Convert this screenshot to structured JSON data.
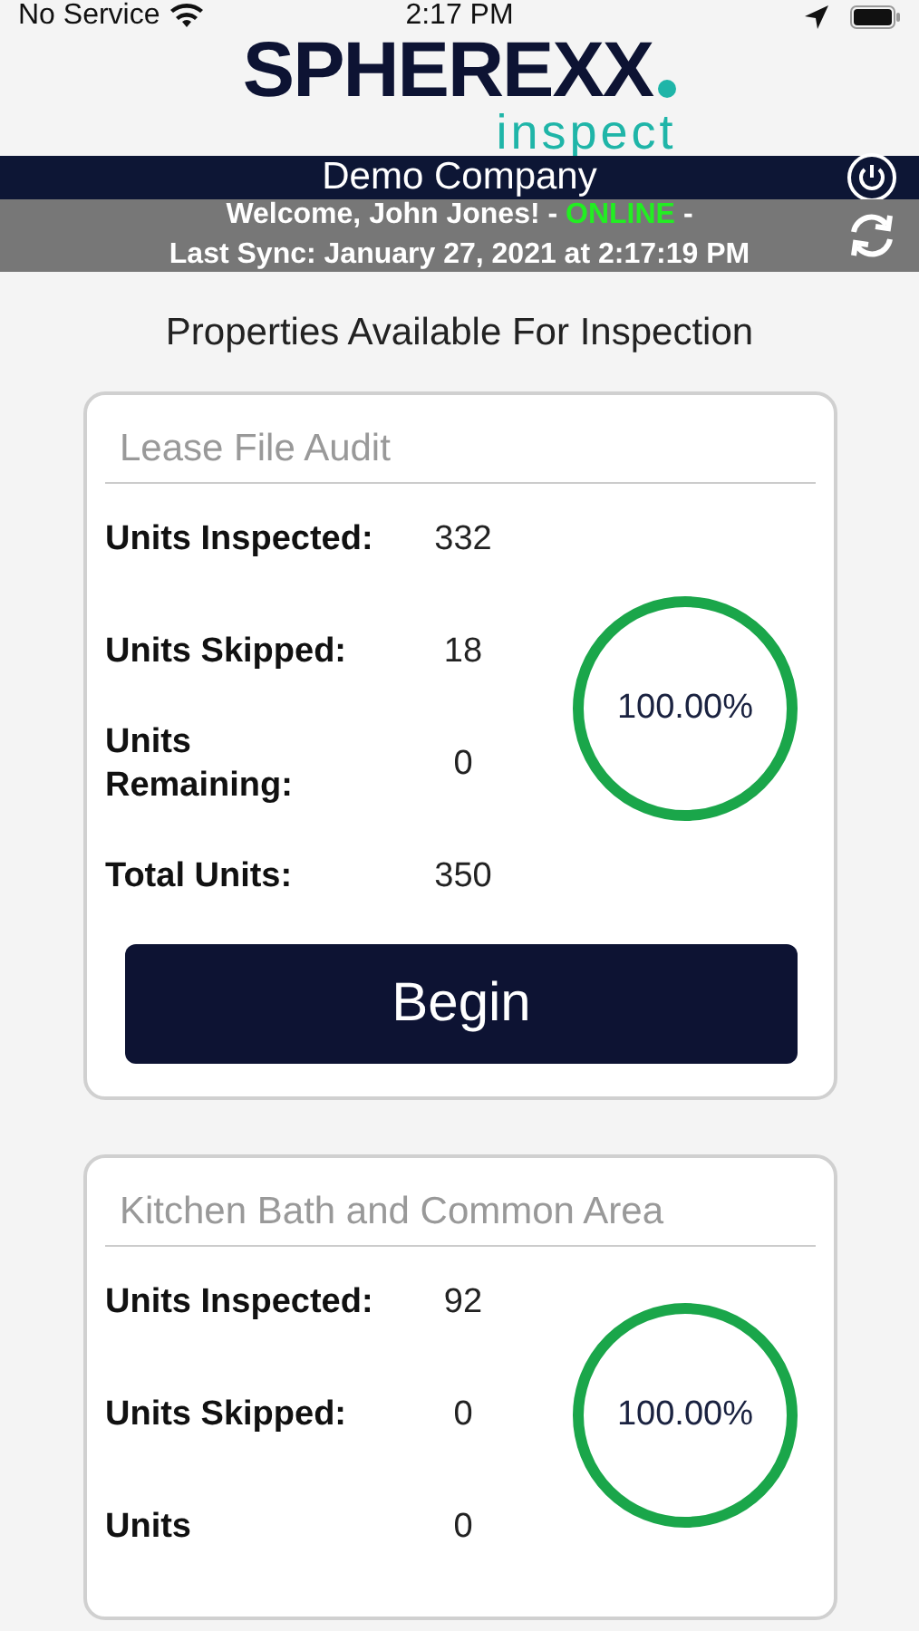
{
  "status_bar": {
    "carrier": "No Service",
    "time": "2:17 PM"
  },
  "logo": {
    "brand": "SPHEREXX",
    "product": "inspect"
  },
  "header": {
    "title": "Demo Company"
  },
  "sync_bar": {
    "welcome": "Welcome, John Jones! -",
    "connection": {
      "label": "ONLINE",
      "online": true
    },
    "suffix": "-",
    "last_sync": "Last Sync: January 27, 2021 at 2:17:19 PM"
  },
  "page_title": "Properties Available For Inspection",
  "properties": [
    {
      "name": "Lease File Audit",
      "stats": [
        {
          "label": "Units Inspected:",
          "value": "332"
        },
        {
          "label": "Units Skipped:",
          "value": "18"
        },
        {
          "label": "Units Remaining:",
          "value": "0"
        },
        {
          "label": "Total Units:",
          "value": "350"
        }
      ],
      "progress": {
        "level": 1,
        "reading": "100.00%"
      },
      "button": "Begin"
    },
    {
      "name": "Kitchen Bath and Common Area",
      "stats": [
        {
          "label": "Units Inspected:",
          "value": "92"
        },
        {
          "label": "Units Skipped:",
          "value": "0"
        },
        {
          "label": "Units",
          "value": "0"
        }
      ],
      "progress": {
        "level": 1,
        "reading": "100.00%"
      }
    }
  ]
}
